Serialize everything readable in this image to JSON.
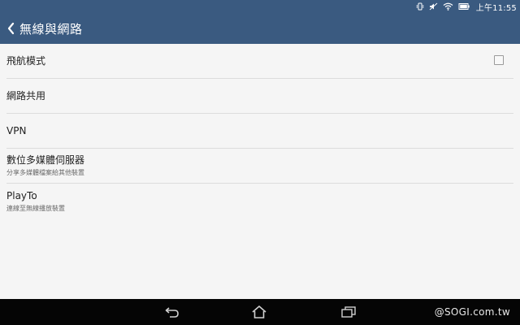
{
  "status_bar": {
    "time": "上午11:55",
    "icons": [
      "vibrate-icon",
      "mute-icon",
      "wifi-icon",
      "battery-icon"
    ]
  },
  "header": {
    "title": "無線與網路",
    "back_icon": "chevron-left-icon"
  },
  "items": [
    {
      "title": "飛航模式",
      "subtitle": "",
      "checked": false
    },
    {
      "title": "網路共用",
      "subtitle": ""
    },
    {
      "title": "VPN",
      "subtitle": ""
    },
    {
      "title": "數位多媒體伺服器",
      "subtitle": "分享多媒體檔案給其他裝置"
    },
    {
      "title": "PlayTo",
      "subtitle": "連線至無線播放裝置"
    }
  ],
  "nav_bar": {
    "buttons": [
      "back-icon",
      "home-icon",
      "recents-icon"
    ],
    "watermark": "@SOGI.com.tw"
  },
  "colors": {
    "header_bg": "#3a5a80",
    "content_bg": "#f5f5f5",
    "nav_bg": "#050505"
  }
}
